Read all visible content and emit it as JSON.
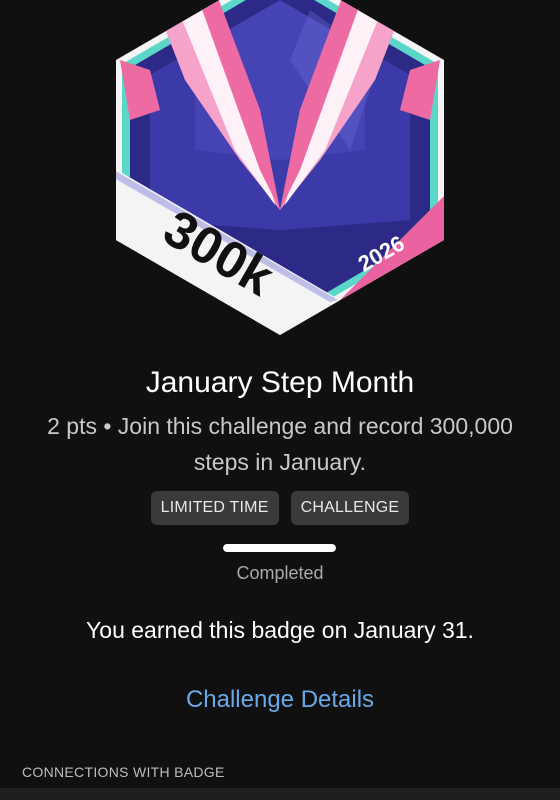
{
  "badge": {
    "main_text": "300k",
    "year": "2026",
    "colors": {
      "outline_teal": "#5ad7c8",
      "inner_dark": "#2c2a86",
      "inner_mid": "#3c3aa8",
      "wings_pink": "#f6a3c9",
      "wings_hot": "#ee6aa2",
      "band_white": "#f4f4f4",
      "band_pink": "#ea62a0"
    }
  },
  "title": "January Step Month",
  "description": "2 pts • Join this challenge and record 300,000 steps in January.",
  "tags": [
    "LIMITED TIME",
    "CHALLENGE"
  ],
  "progress": {
    "value": 1.0,
    "status": "Completed"
  },
  "earned_text": "You earned this badge on January 31.",
  "details_link": "Challenge Details",
  "connections_header": "CONNECTIONS WITH BADGE"
}
